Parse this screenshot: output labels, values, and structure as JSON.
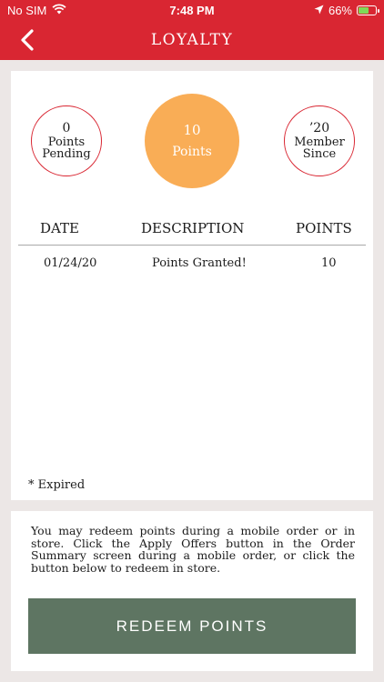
{
  "status_bar": {
    "carrier": "No SIM",
    "time": "7:48 PM",
    "battery": "66%",
    "battery_level": 0.66
  },
  "nav": {
    "title": "LOYALTY"
  },
  "summary": {
    "pending": {
      "value": "0",
      "label_line1": "Points",
      "label_line2": "Pending"
    },
    "points": {
      "value": "10",
      "label": "Points"
    },
    "member": {
      "value": "’20",
      "label_line1": "Member",
      "label_line2": "Since"
    }
  },
  "table": {
    "headers": {
      "date": "DATE",
      "description": "DESCRIPTION",
      "points": "POINTS"
    },
    "rows": [
      {
        "date": "01/24/20",
        "description": "Points Granted!",
        "points": "10"
      }
    ]
  },
  "expired_note": "* Expired",
  "info": {
    "text": "You may redeem points during a mobile order or in store. Click the  Apply Offers  button in the Order Summary screen during a mobile order, or click the button below to redeem in store.",
    "button_label": "REDEEM POINTS"
  },
  "colors": {
    "header": "#d92632",
    "points_circle": "#f9ad56",
    "button": "#5e7562",
    "background": "#ece7e6"
  }
}
